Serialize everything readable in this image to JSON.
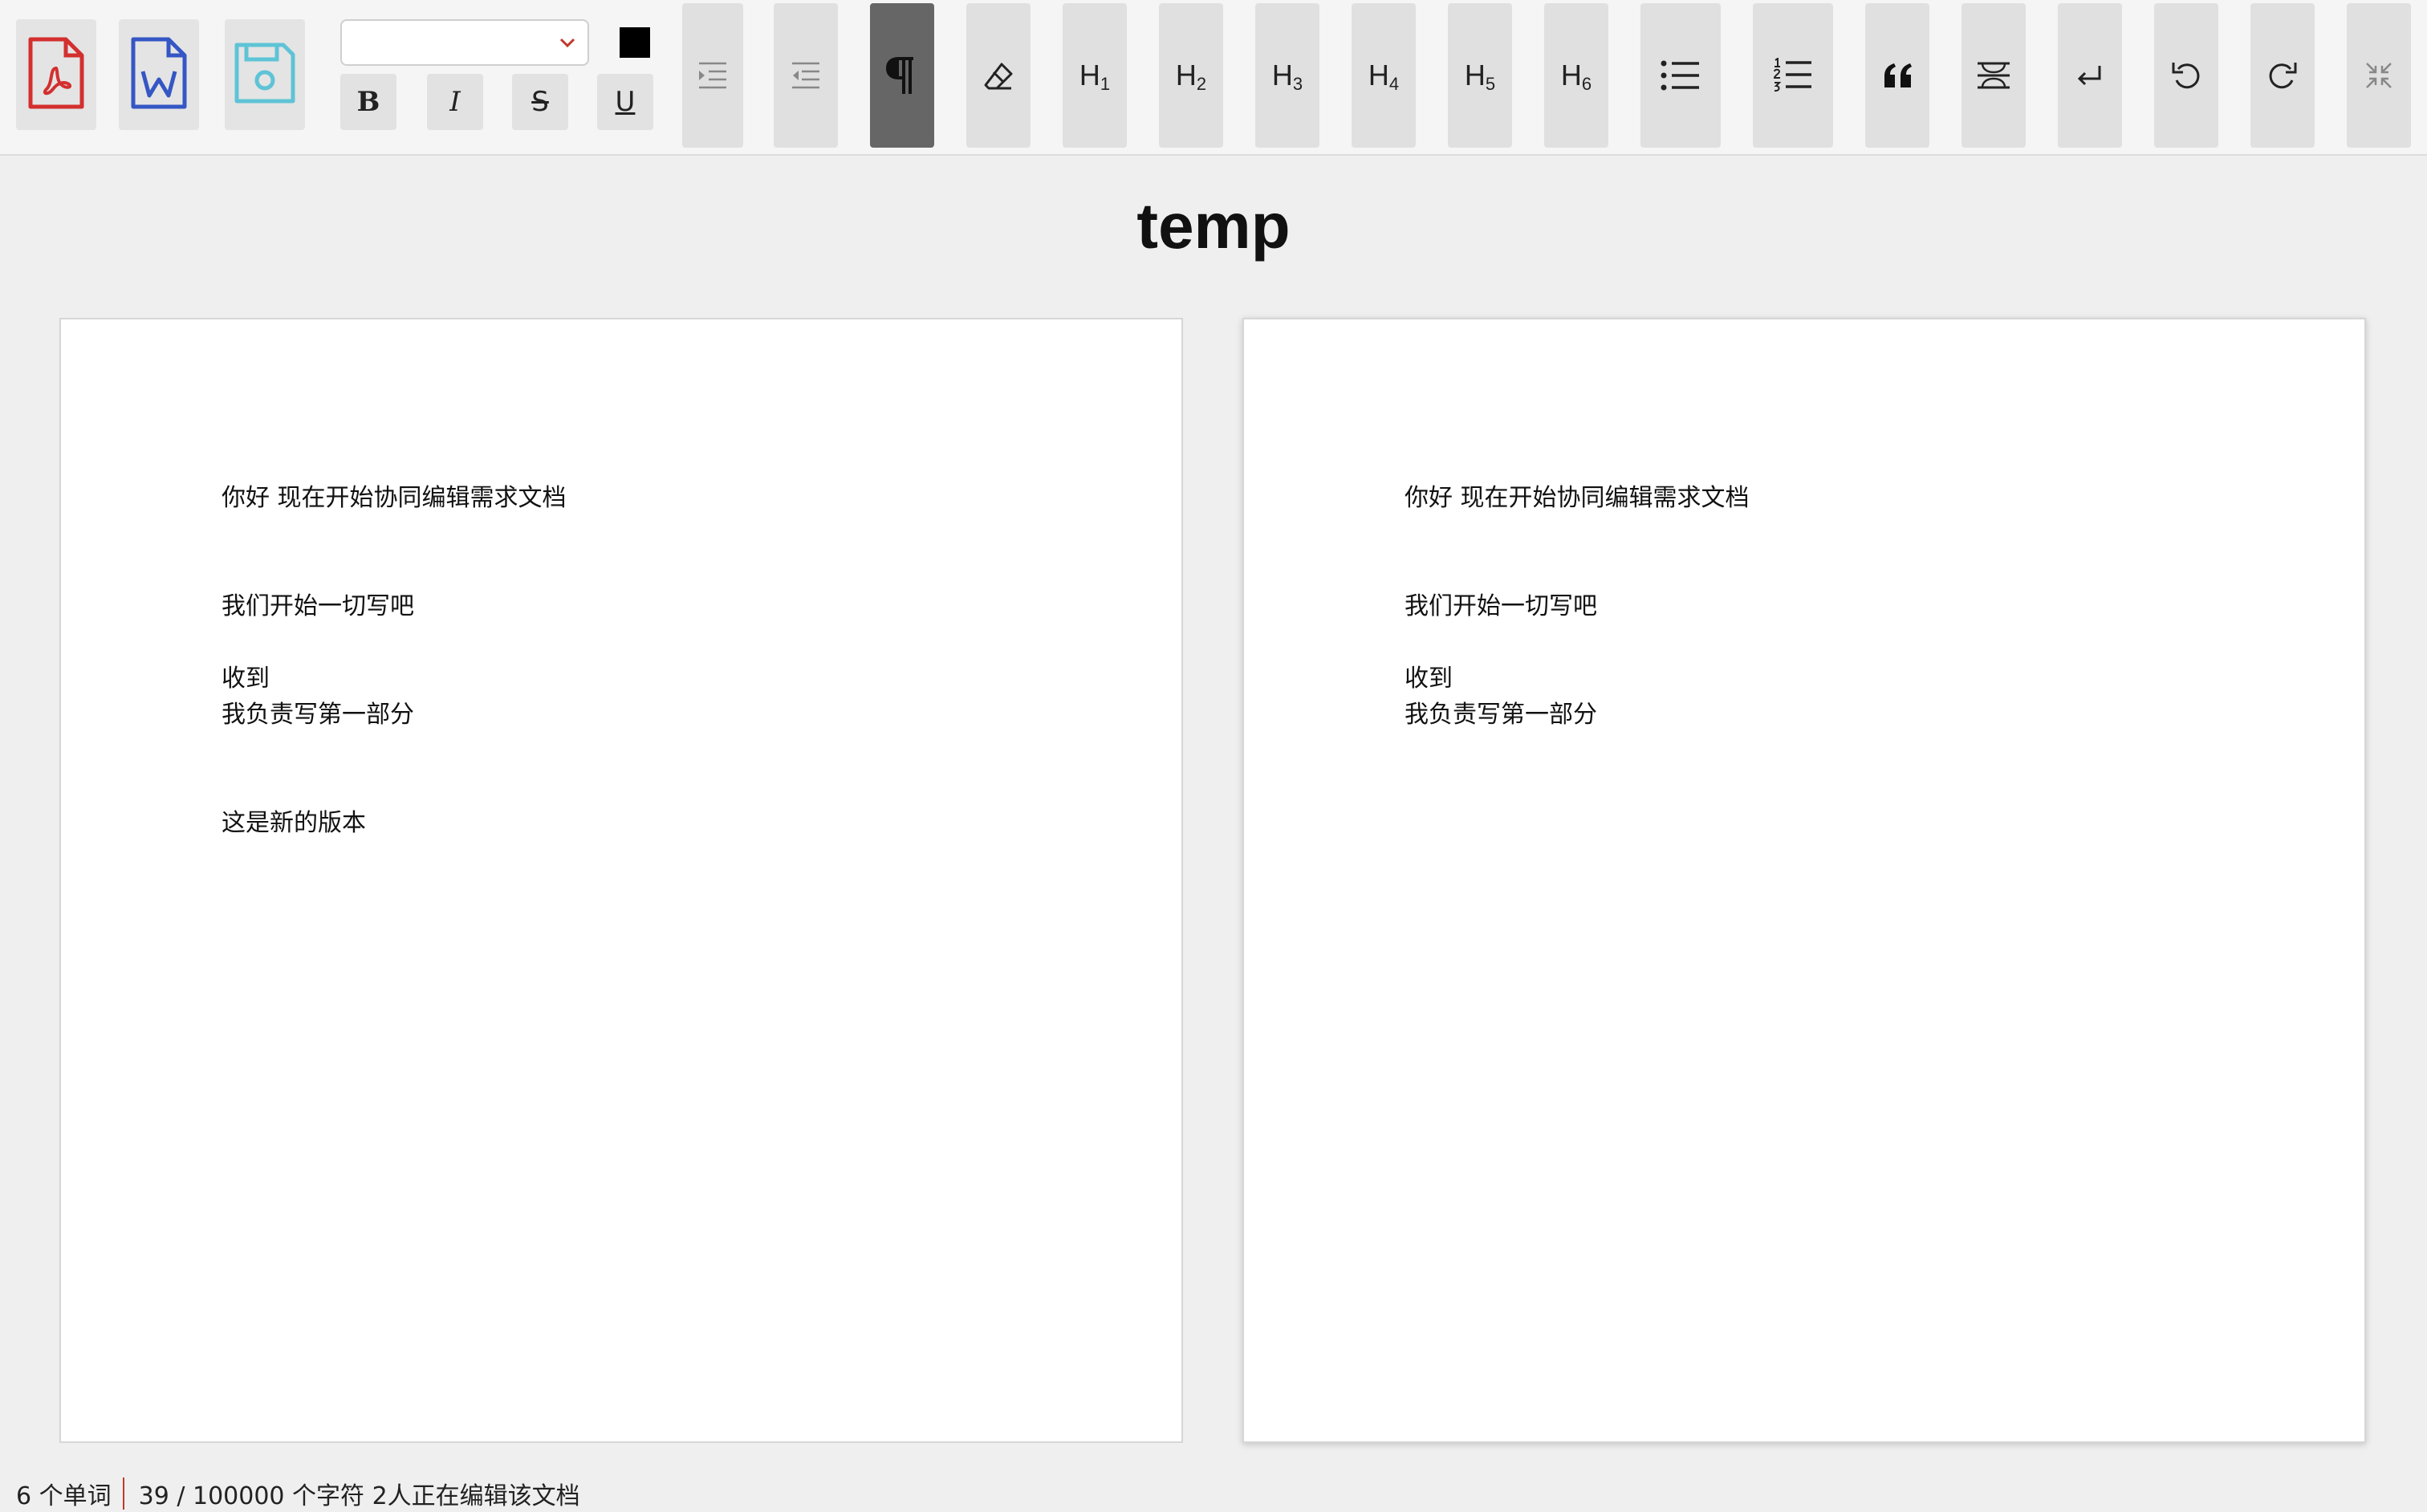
{
  "document": {
    "title": "temp"
  },
  "toolbar": {
    "file_buttons": [
      {
        "name": "export-pdf",
        "icon": "pdf-file-icon",
        "color": "#d32f2f"
      },
      {
        "name": "export-word",
        "icon": "word-file-icon",
        "color": "#3556c4"
      },
      {
        "name": "save",
        "icon": "floppy-disk-icon",
        "color": "#5fc3d6"
      }
    ],
    "font_select_value": "",
    "text_color": "#000000",
    "format": {
      "bold": "B",
      "italic": "I",
      "strike": "S",
      "underline": "U"
    },
    "headings": {
      "h1": {
        "main": "H",
        "sub": "1"
      },
      "h2": {
        "main": "H",
        "sub": "2"
      },
      "h3": {
        "main": "H",
        "sub": "3"
      },
      "h4": {
        "main": "H",
        "sub": "4"
      },
      "h5": {
        "main": "H",
        "sub": "5"
      },
      "h6": {
        "main": "H",
        "sub": "6"
      }
    },
    "paragraph_active": true,
    "active_color": "#666666"
  },
  "editor_left": {
    "lines": [
      "你好 现在开始协同编辑需求文档",
      "",
      "",
      "我们开始一切写吧",
      "",
      "收到",
      "我负责写第一部分",
      "",
      "",
      "这是新的版本"
    ]
  },
  "editor_right": {
    "lines": [
      "你好 现在开始协同编辑需求文档",
      "",
      "",
      "我们开始一切写吧",
      "",
      "收到",
      "我负责写第一部分"
    ]
  },
  "status": {
    "words": "6 个单词",
    "chars": "39 / 100000 个字符 2人正在编辑该文档"
  }
}
